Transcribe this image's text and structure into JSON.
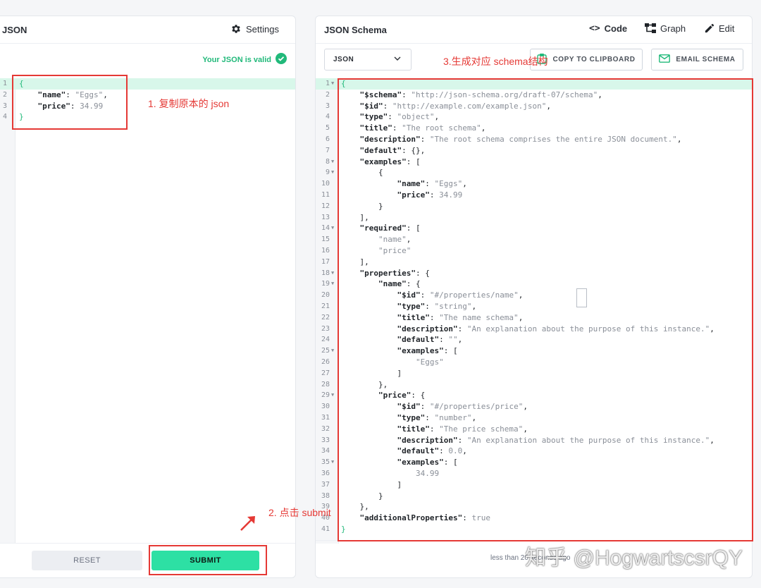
{
  "left_panel": {
    "title": "JSON",
    "settings_label": "Settings",
    "valid_text": "Your JSON is valid",
    "reset_label": "RESET",
    "submit_label": "SUBMIT",
    "code_lines": [
      [
        {
          "t": "{",
          "c": "b"
        }
      ],
      [
        {
          "t": "    ",
          "c": "p"
        },
        {
          "t": "\"name\"",
          "c": "k"
        },
        {
          "t": ": ",
          "c": "p"
        },
        {
          "t": "\"Eggs\"",
          "c": "s"
        },
        {
          "t": ",",
          "c": "p"
        }
      ],
      [
        {
          "t": "    ",
          "c": "p"
        },
        {
          "t": "\"price\"",
          "c": "k"
        },
        {
          "t": ": ",
          "c": "p"
        },
        {
          "t": "34.99",
          "c": "s"
        }
      ],
      [
        {
          "t": "}",
          "c": "b"
        }
      ]
    ]
  },
  "right_panel": {
    "title": "JSON Schema",
    "code_label": "Code",
    "graph_label": "Graph",
    "edit_label": "Edit",
    "format_value": "JSON",
    "copy_label": "COPY TO CLIPBOARD",
    "email_label": "EMAIL SCHEMA",
    "footer_text": "less than 20 seconds ago",
    "code_lines": [
      [
        {
          "t": "{",
          "c": "b"
        }
      ],
      [
        {
          "t": "    ",
          "c": "p"
        },
        {
          "t": "\"$schema\"",
          "c": "k"
        },
        {
          "t": ": ",
          "c": "p"
        },
        {
          "t": "\"http://json-schema.org/draft-07/schema\"",
          "c": "s"
        },
        {
          "t": ",",
          "c": "p"
        }
      ],
      [
        {
          "t": "    ",
          "c": "p"
        },
        {
          "t": "\"$id\"",
          "c": "k"
        },
        {
          "t": ": ",
          "c": "p"
        },
        {
          "t": "\"http://example.com/example.json\"",
          "c": "s"
        },
        {
          "t": ",",
          "c": "p"
        }
      ],
      [
        {
          "t": "    ",
          "c": "p"
        },
        {
          "t": "\"type\"",
          "c": "k"
        },
        {
          "t": ": ",
          "c": "p"
        },
        {
          "t": "\"object\"",
          "c": "s"
        },
        {
          "t": ",",
          "c": "p"
        }
      ],
      [
        {
          "t": "    ",
          "c": "p"
        },
        {
          "t": "\"title\"",
          "c": "k"
        },
        {
          "t": ": ",
          "c": "p"
        },
        {
          "t": "\"The root schema\"",
          "c": "s"
        },
        {
          "t": ",",
          "c": "p"
        }
      ],
      [
        {
          "t": "    ",
          "c": "p"
        },
        {
          "t": "\"description\"",
          "c": "k"
        },
        {
          "t": ": ",
          "c": "p"
        },
        {
          "t": "\"The root schema comprises the entire JSON document.\"",
          "c": "s"
        },
        {
          "t": ",",
          "c": "p"
        }
      ],
      [
        {
          "t": "    ",
          "c": "p"
        },
        {
          "t": "\"default\"",
          "c": "k"
        },
        {
          "t": ": {},",
          "c": "p"
        }
      ],
      [
        {
          "t": "    ",
          "c": "p"
        },
        {
          "t": "\"examples\"",
          "c": "k"
        },
        {
          "t": ": [",
          "c": "p"
        }
      ],
      [
        {
          "t": "        {",
          "c": "p"
        }
      ],
      [
        {
          "t": "            ",
          "c": "p"
        },
        {
          "t": "\"name\"",
          "c": "k"
        },
        {
          "t": ": ",
          "c": "p"
        },
        {
          "t": "\"Eggs\"",
          "c": "s"
        },
        {
          "t": ",",
          "c": "p"
        }
      ],
      [
        {
          "t": "            ",
          "c": "p"
        },
        {
          "t": "\"price\"",
          "c": "k"
        },
        {
          "t": ": ",
          "c": "p"
        },
        {
          "t": "34.99",
          "c": "s"
        }
      ],
      [
        {
          "t": "        }",
          "c": "p"
        }
      ],
      [
        {
          "t": "    ],",
          "c": "p"
        }
      ],
      [
        {
          "t": "    ",
          "c": "p"
        },
        {
          "t": "\"required\"",
          "c": "k"
        },
        {
          "t": ": [",
          "c": "p"
        }
      ],
      [
        {
          "t": "        ",
          "c": "p"
        },
        {
          "t": "\"name\"",
          "c": "s"
        },
        {
          "t": ",",
          "c": "p"
        }
      ],
      [
        {
          "t": "        ",
          "c": "p"
        },
        {
          "t": "\"price\"",
          "c": "s"
        }
      ],
      [
        {
          "t": "    ],",
          "c": "p"
        }
      ],
      [
        {
          "t": "    ",
          "c": "p"
        },
        {
          "t": "\"properties\"",
          "c": "k"
        },
        {
          "t": ": {",
          "c": "p"
        }
      ],
      [
        {
          "t": "        ",
          "c": "p"
        },
        {
          "t": "\"name\"",
          "c": "k"
        },
        {
          "t": ": {",
          "c": "p"
        }
      ],
      [
        {
          "t": "            ",
          "c": "p"
        },
        {
          "t": "\"$id\"",
          "c": "k"
        },
        {
          "t": ": ",
          "c": "p"
        },
        {
          "t": "\"#/properties/name\"",
          "c": "s"
        },
        {
          "t": ",",
          "c": "p"
        }
      ],
      [
        {
          "t": "            ",
          "c": "p"
        },
        {
          "t": "\"type\"",
          "c": "k"
        },
        {
          "t": ": ",
          "c": "p"
        },
        {
          "t": "\"string\"",
          "c": "s"
        },
        {
          "t": ",",
          "c": "p"
        }
      ],
      [
        {
          "t": "            ",
          "c": "p"
        },
        {
          "t": "\"title\"",
          "c": "k"
        },
        {
          "t": ": ",
          "c": "p"
        },
        {
          "t": "\"The name schema\"",
          "c": "s"
        },
        {
          "t": ",",
          "c": "p"
        }
      ],
      [
        {
          "t": "            ",
          "c": "p"
        },
        {
          "t": "\"description\"",
          "c": "k"
        },
        {
          "t": ": ",
          "c": "p"
        },
        {
          "t": "\"An explanation about the purpose of this instance.\"",
          "c": "s"
        },
        {
          "t": ",",
          "c": "p"
        }
      ],
      [
        {
          "t": "            ",
          "c": "p"
        },
        {
          "t": "\"default\"",
          "c": "k"
        },
        {
          "t": ": ",
          "c": "p"
        },
        {
          "t": "\"\"",
          "c": "s"
        },
        {
          "t": ",",
          "c": "p"
        }
      ],
      [
        {
          "t": "            ",
          "c": "p"
        },
        {
          "t": "\"examples\"",
          "c": "k"
        },
        {
          "t": ": [",
          "c": "p"
        }
      ],
      [
        {
          "t": "                ",
          "c": "p"
        },
        {
          "t": "\"Eggs\"",
          "c": "s"
        }
      ],
      [
        {
          "t": "            ]",
          "c": "p"
        }
      ],
      [
        {
          "t": "        },",
          "c": "p"
        }
      ],
      [
        {
          "t": "        ",
          "c": "p"
        },
        {
          "t": "\"price\"",
          "c": "k"
        },
        {
          "t": ": {",
          "c": "p"
        }
      ],
      [
        {
          "t": "            ",
          "c": "p"
        },
        {
          "t": "\"$id\"",
          "c": "k"
        },
        {
          "t": ": ",
          "c": "p"
        },
        {
          "t": "\"#/properties/price\"",
          "c": "s"
        },
        {
          "t": ",",
          "c": "p"
        }
      ],
      [
        {
          "t": "            ",
          "c": "p"
        },
        {
          "t": "\"type\"",
          "c": "k"
        },
        {
          "t": ": ",
          "c": "p"
        },
        {
          "t": "\"number\"",
          "c": "s"
        },
        {
          "t": ",",
          "c": "p"
        }
      ],
      [
        {
          "t": "            ",
          "c": "p"
        },
        {
          "t": "\"title\"",
          "c": "k"
        },
        {
          "t": ": ",
          "c": "p"
        },
        {
          "t": "\"The price schema\"",
          "c": "s"
        },
        {
          "t": ",",
          "c": "p"
        }
      ],
      [
        {
          "t": "            ",
          "c": "p"
        },
        {
          "t": "\"description\"",
          "c": "k"
        },
        {
          "t": ": ",
          "c": "p"
        },
        {
          "t": "\"An explanation about the purpose of this instance.\"",
          "c": "s"
        },
        {
          "t": ",",
          "c": "p"
        }
      ],
      [
        {
          "t": "            ",
          "c": "p"
        },
        {
          "t": "\"default\"",
          "c": "k"
        },
        {
          "t": ": ",
          "c": "p"
        },
        {
          "t": "0.0",
          "c": "s"
        },
        {
          "t": ",",
          "c": "p"
        }
      ],
      [
        {
          "t": "            ",
          "c": "p"
        },
        {
          "t": "\"examples\"",
          "c": "k"
        },
        {
          "t": ": [",
          "c": "p"
        }
      ],
      [
        {
          "t": "                ",
          "c": "p"
        },
        {
          "t": "34.99",
          "c": "s"
        }
      ],
      [
        {
          "t": "            ]",
          "c": "p"
        }
      ],
      [
        {
          "t": "        }",
          "c": "p"
        }
      ],
      [
        {
          "t": "    },",
          "c": "p"
        }
      ],
      [
        {
          "t": "    ",
          "c": "p"
        },
        {
          "t": "\"additionalProperties\"",
          "c": "k"
        },
        {
          "t": ": ",
          "c": "p"
        },
        {
          "t": "true",
          "c": "s"
        }
      ],
      [
        {
          "t": "}",
          "c": "b"
        }
      ]
    ],
    "fold_lines": [
      1,
      8,
      9,
      14,
      18,
      19,
      25,
      29,
      35
    ]
  },
  "annotations": {
    "step1": "1. 复制原本的 json",
    "step2": "2. 点击 submit",
    "step3": "3.生成对应 schema结构"
  },
  "watermark": "知乎 @HogwartscsrQY",
  "colors": {
    "accent": "#2de0a4",
    "valid": "#21b97a",
    "annotation": "#e53935"
  }
}
